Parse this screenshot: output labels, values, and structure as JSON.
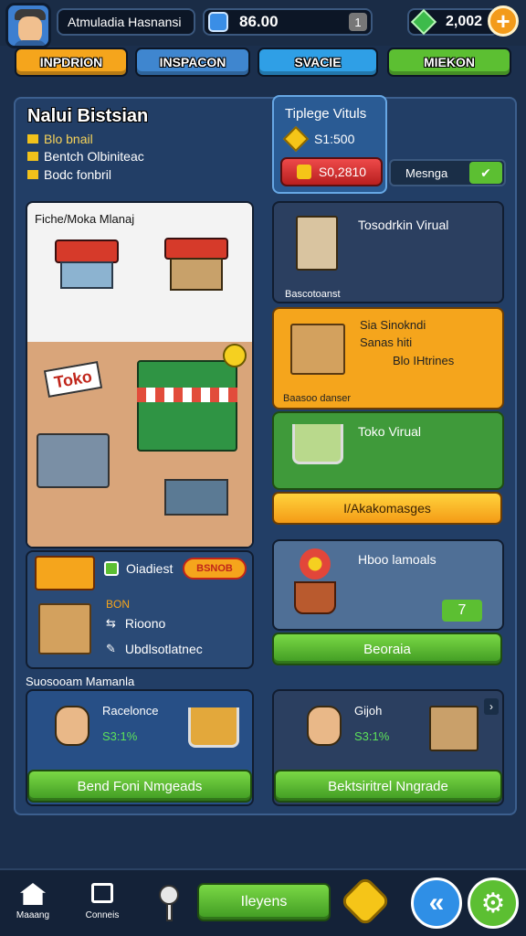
{
  "header": {
    "player_name": "Atmuladia Hasnansi",
    "cash": "86.00",
    "cash_badge": "1",
    "gems": "2,002"
  },
  "tabs": [
    {
      "label": "INPDRION",
      "color": "#f5a51c"
    },
    {
      "label": "INSPACON",
      "color": "#3f86cf"
    },
    {
      "label": "SVACIE",
      "color": "#2f9fe6"
    },
    {
      "label": "MIEKON",
      "color": "#5cbf32"
    }
  ],
  "business": {
    "title": "Nalui Bistsian",
    "items": [
      "Blo bnail",
      "Bentch Olbiniteac",
      "Bodc fonbril"
    ]
  },
  "upgrade_panel": {
    "title": "Tiplege Vituls",
    "price": "S1:500",
    "cost_button": "S0,2810",
    "manage_label": "Mesnga"
  },
  "shop_card": {
    "title": "Fiche/Moka Mlanaj",
    "sign": "Toko"
  },
  "inventory_card": {
    "title": "Oiadiest",
    "tag": "BSNOB",
    "price": "BON",
    "row1": "Rioono",
    "row2": "Ubdlsotlatnec"
  },
  "right_cards": {
    "card1_title": "Tosodrkin Virual",
    "card1_footer": "Bascotoanst",
    "card2_line1": "Sia Sinokndi",
    "card2_line2": "Sanas hiti",
    "card2_line3": "Blo IHtrines",
    "card2_footer": "Baasoo danser",
    "card3_title": "Toko Virual",
    "orange_button": "I/Akakomasges",
    "card4_title": "Hboo lamoals",
    "card4_badge": "7",
    "upgrade_button": "Beoraia"
  },
  "section_label": "Suosooam Mamanla",
  "staff": [
    {
      "name": "Racelonce",
      "stat": "S3:1%",
      "button": "Bend Foni Nmgeads"
    },
    {
      "name": "Gijoh",
      "stat": "S3:1%",
      "button": "Bektsiritrel Nngrade"
    }
  ],
  "bottom_nav": {
    "home_label": "Maaang",
    "connect_label": "Conneis",
    "center_button": "Ileyens"
  }
}
